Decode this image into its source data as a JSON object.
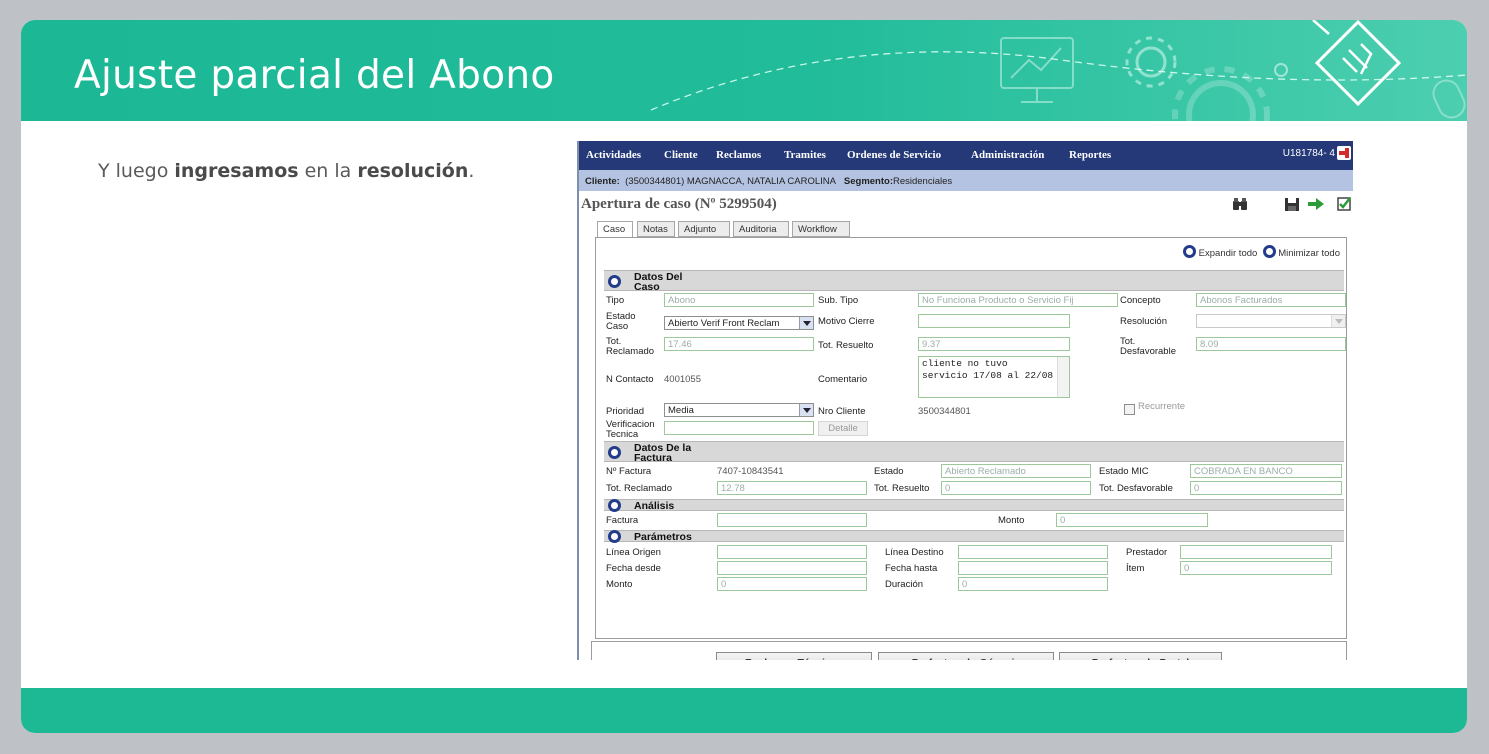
{
  "slide": {
    "title": "Ajuste parcial del Abono",
    "body": {
      "pre": "Y luego ",
      "b1": "ingresamos",
      "mid": " en la ",
      "b2": "resolución",
      "post": "."
    }
  },
  "colors": {
    "header": "#21bc9a",
    "footer": "#1db994",
    "menubar": "#253978",
    "clientbar": "#b4c3e1"
  },
  "app": {
    "menu": [
      "Actividades",
      "Cliente",
      "Reclamos",
      "Tramites",
      "Ordenes de Servicio",
      "Administración",
      "Reportes"
    ],
    "user_id": "U181784- 4",
    "client": {
      "label": "Cliente:",
      "value": "(3500344801) MAGNACCA, NATALIA CAROLINA",
      "seg_label": "Segmento:",
      "seg_value": "Residenciales"
    },
    "page_title": "Apertura de caso (Nº 5299504)",
    "toolbar_icons": [
      "binoculars-icon",
      "save-icon",
      "forward-arrow-icon",
      "checklist-icon"
    ],
    "tabs": [
      "Caso",
      "Notas",
      "Adjunto",
      "Auditoria",
      "Workflow"
    ],
    "expand_all": "Expandir todo",
    "minimize_all": "Minimizar todo",
    "datos_caso": {
      "header": [
        "Datos Del",
        "Caso"
      ],
      "tipo_label": "Tipo",
      "tipo_value": "Abono",
      "subtipo_label": "Sub. Tipo",
      "subtipo_value": "No Funciona Producto o Servicio Fij",
      "concepto_label": "Concepto",
      "concepto_value": "Abonos Facturados",
      "estado_label": [
        "Estado",
        "Caso"
      ],
      "estado_value": "Abierto Verif Front Reclam",
      "motivo_label": "Motivo Cierre",
      "motivo_value": "",
      "resolucion_label": "Resolución",
      "resolucion_value": "",
      "tot_reclamado_label": [
        "Tot.",
        "Reclamado"
      ],
      "tot_reclamado_value": "17.46",
      "tot_resuelto_label": "Tot. Resuelto",
      "tot_resuelto_value": "9.37",
      "tot_desfav_label": [
        "Tot.",
        "Desfavorable"
      ],
      "tot_desfav_value": "8.09",
      "ncontacto_label": "N Contacto",
      "ncontacto_value": "4001055",
      "comentario_label": "Comentario",
      "comentario_lines": [
        "cliente no tuvo",
        "servicio 17/08 al 22/08"
      ],
      "prioridad_label": "Prioridad",
      "prioridad_value": "Media",
      "nrocliente_label": "Nro Cliente",
      "nrocliente_value": "3500344801",
      "recurrente_label": "Recurrente",
      "verif_label": [
        "Verificacion",
        "Tecnica"
      ],
      "verif_value": "",
      "detalle_btn": "Detalle"
    },
    "datos_factura": {
      "header": [
        "Datos De la",
        "Factura"
      ],
      "nro_label": "Nº Factura",
      "nro_value": "7407-10843541",
      "estado_label": "Estado",
      "estado_value": "Abierto Reclamado",
      "estado_mic_label": "Estado MIC",
      "estado_mic_value": "COBRADA EN BANCO",
      "tot_reclamado_label": "Tot. Reclamado",
      "tot_reclamado_value": "12.78",
      "tot_resuelto_label": "Tot. Resuelto",
      "tot_resuelto_value": "0",
      "tot_desfav_label": "Tot. Desfavorable",
      "tot_desfav_value": "0"
    },
    "analisis": {
      "header": "Análisis",
      "factura_label": "Factura",
      "factura_value": "",
      "monto_label": "Monto",
      "monto_value": "0"
    },
    "parametros": {
      "header": "Parámetros",
      "linea_origen": "Línea Origen",
      "linea_destino": "Línea Destino",
      "prestador": "Prestador",
      "fecha_desde": "Fecha desde",
      "fecha_hasta": "Fecha hasta",
      "item": "Ítem",
      "item_value": "0",
      "monto": "Monto",
      "monto_value": "0",
      "duracion": "Duración",
      "duracion_value": "0"
    },
    "buttons": [
      "Reclamos Técnicos",
      "Prefacturado Génesis",
      "Prefacturado Portal"
    ]
  }
}
